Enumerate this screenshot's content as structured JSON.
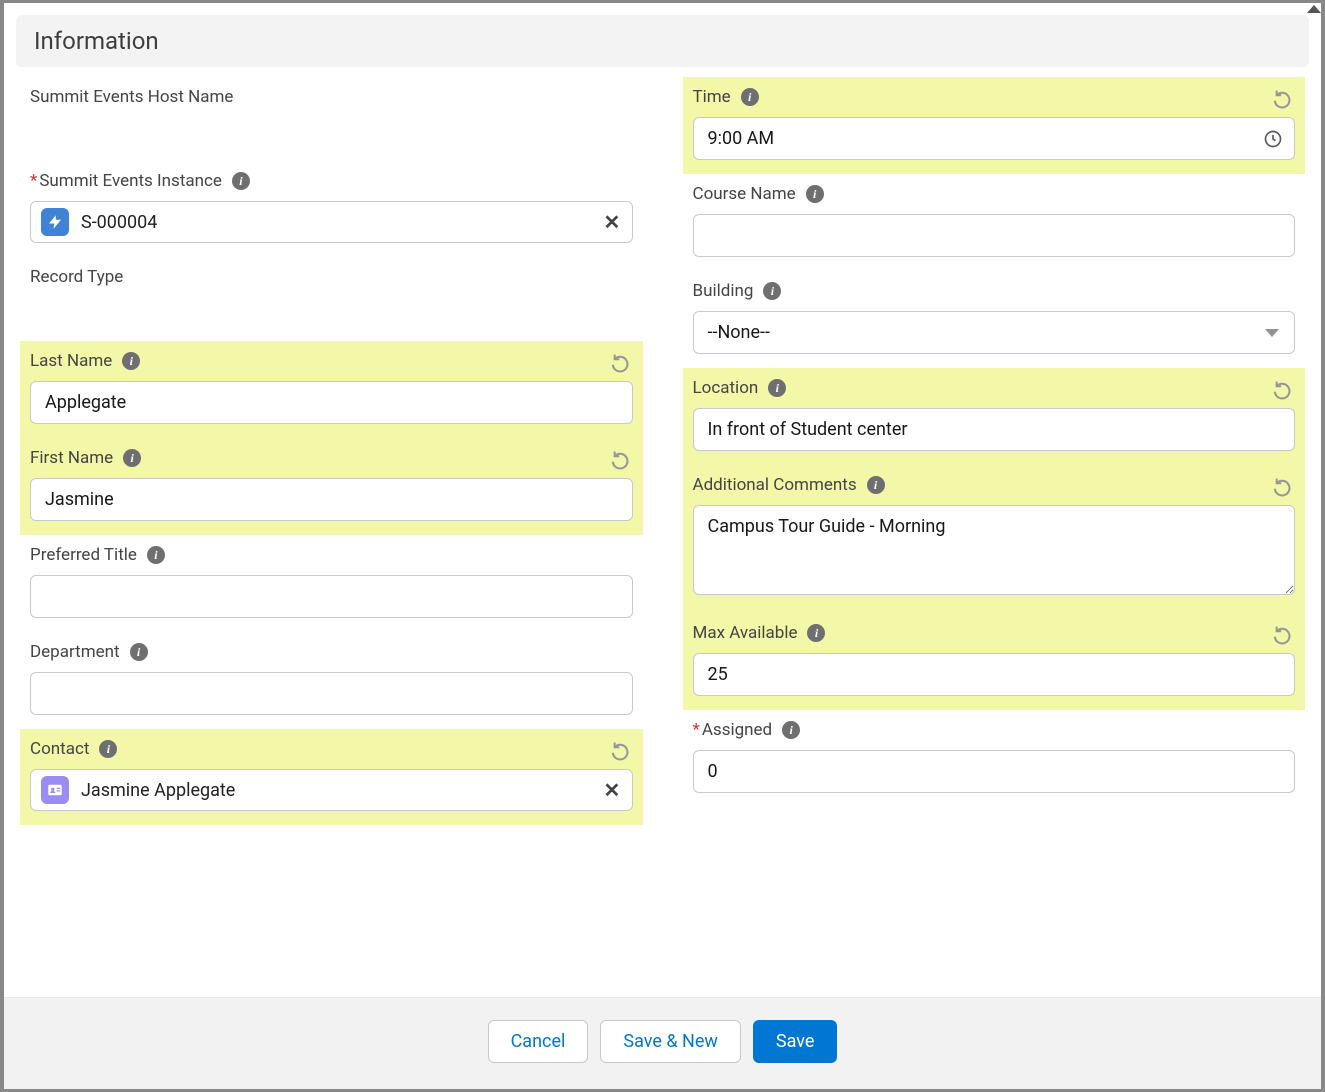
{
  "section_title": "Information",
  "left": {
    "host_name": {
      "label": "Summit Events Host Name"
    },
    "instance": {
      "label": "Summit Events Instance",
      "value": "S-000004"
    },
    "record_type": {
      "label": "Record Type"
    },
    "last_name": {
      "label": "Last Name",
      "value": "Applegate"
    },
    "first_name": {
      "label": "First Name",
      "value": "Jasmine"
    },
    "preferred_title": {
      "label": "Preferred Title",
      "value": ""
    },
    "department": {
      "label": "Department",
      "value": ""
    },
    "contact": {
      "label": "Contact",
      "value": "Jasmine Applegate"
    }
  },
  "right": {
    "time": {
      "label": "Time",
      "value": "9:00 AM"
    },
    "course_name": {
      "label": "Course Name",
      "value": ""
    },
    "building": {
      "label": "Building",
      "value": "--None--"
    },
    "location": {
      "label": "Location",
      "value": "In front of Student center"
    },
    "additional_comments": {
      "label": "Additional Comments",
      "value": "Campus Tour Guide - Morning"
    },
    "max_available": {
      "label": "Max Available",
      "value": "25"
    },
    "assigned": {
      "label": "Assigned",
      "value": "0"
    }
  },
  "footer": {
    "cancel": "Cancel",
    "save_new": "Save & New",
    "save": "Save"
  }
}
